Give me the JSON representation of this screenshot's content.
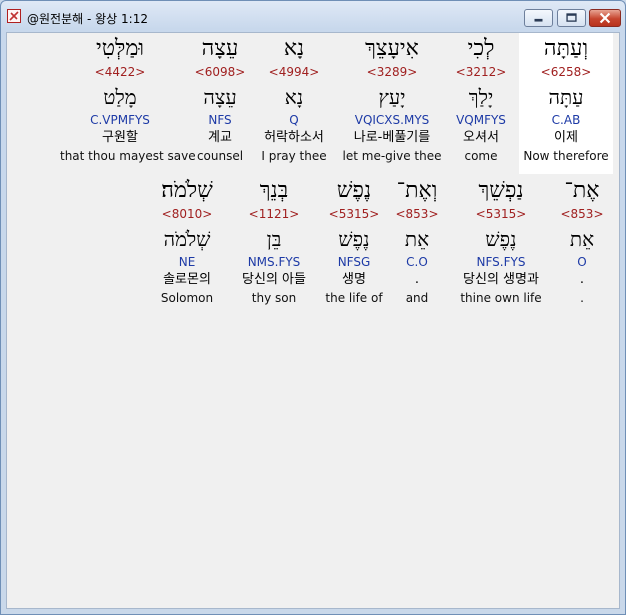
{
  "window": {
    "title": "@원전분해 - 왕상 1:12"
  },
  "rows": [
    [
      {
        "heb": "וְעַתָּה",
        "strong": "<6258>",
        "heb2": "עַתָּה",
        "morph": "C.AB",
        "kor": "이제",
        "eng": "Now therefore",
        "highlight": true
      },
      {
        "heb": "לְכִי",
        "strong": "<3212>",
        "heb2": "יָלַךְ",
        "morph": "VQMFYS",
        "kor": "오셔서",
        "eng": "come"
      },
      {
        "heb": "אִיעָצֵךְ",
        "strong": "<3289>",
        "heb2": "יָעַץ",
        "morph": "VQICXS.MYS",
        "kor": "나로-베풀기를",
        "eng": "let me-give thee"
      },
      {
        "heb": "נָא",
        "strong": "<4994>",
        "heb2": "נָא",
        "morph": "Q",
        "kor": "허락하소서",
        "eng": "I pray thee"
      },
      {
        "heb": "עֵצָה",
        "strong": "<6098>",
        "heb2": "עֵצָה",
        "morph": "NFS",
        "kor": "계교",
        "eng": "counsel"
      },
      {
        "heb": "וּמַלְּטִי",
        "strong": "<4422>",
        "heb2": "מָלַט",
        "morph": "C.VPMFYS",
        "kor": "구원할",
        "eng": "that thou mayest save"
      }
    ],
    [
      {
        "heb": "אֶת־",
        "strong": "<853>",
        "heb2": "אֵת",
        "morph": "O",
        "kor": ".",
        "eng": "."
      },
      {
        "heb": "נַפְשֵׁךְ",
        "strong": "<5315>",
        "heb2": "נֶפֶשׁ",
        "morph": "NFS.FYS",
        "kor": "당신의 생명과",
        "eng": "thine own life"
      },
      {
        "heb": "וְאֶת־",
        "strong": "<853>",
        "heb2": "אֵת",
        "morph": "C.O",
        "kor": ".",
        "eng": "and"
      },
      {
        "heb": "נֶפֶשׁ",
        "strong": "<5315>",
        "heb2": "נֶפֶשׁ",
        "morph": "NFSG",
        "kor": "생명",
        "eng": "the life of"
      },
      {
        "heb": "בְּנֵךְ",
        "strong": "<1121>",
        "heb2": "בֵּן",
        "morph": "NMS.FYS",
        "kor": "당신의 아들",
        "eng": "thy son"
      },
      {
        "heb": "שְׁלֹמֹה׃",
        "strong": "<8010>",
        "heb2": "שְׁלֹמֹה",
        "morph": "NE",
        "kor": "솔로몬의",
        "eng": "Solomon"
      }
    ]
  ]
}
